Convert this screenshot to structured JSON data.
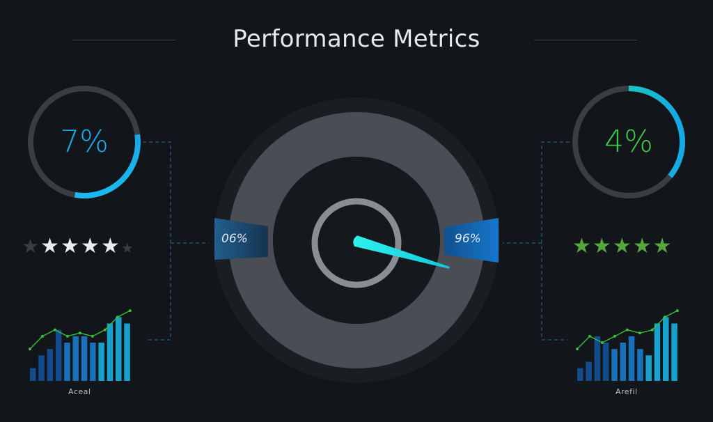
{
  "title": "Performance Metrics",
  "colors": {
    "background": "#121519",
    "accent_blue": "#13a9e6",
    "accent_green": "#3fcf48",
    "needle": "#1de6e6",
    "gauge_ring": "#4a4d53"
  },
  "left_panel": {
    "ring_value": "7%",
    "ring_fill_fraction": 0.3,
    "rating": {
      "filled": 4,
      "total": 6
    },
    "chart_data": {
      "type": "bar",
      "values": [
        2,
        4,
        5,
        8,
        6,
        7,
        7,
        6,
        6,
        9,
        10,
        9
      ],
      "line_values": [
        5,
        7,
        8,
        7,
        7.5,
        7,
        8,
        10,
        11
      ],
      "ylim": [
        0,
        12
      ]
    },
    "caption": "Aceal"
  },
  "right_panel": {
    "ring_value": "4%",
    "ring_fill_fraction": 0.36,
    "rating": {
      "filled": 5,
      "total": 5
    },
    "chart_data": {
      "type": "bar",
      "values": [
        2,
        3,
        7,
        6,
        5,
        6,
        7,
        5,
        4,
        9,
        10,
        9
      ],
      "line_values": [
        5,
        7,
        6,
        7,
        8,
        7.5,
        8,
        10,
        11
      ],
      "ylim": [
        0,
        12
      ]
    },
    "caption": "Arefil"
  },
  "gauge": {
    "left_tab_label": "06%",
    "right_tab_label": "96%",
    "needle_value": 0.62
  }
}
